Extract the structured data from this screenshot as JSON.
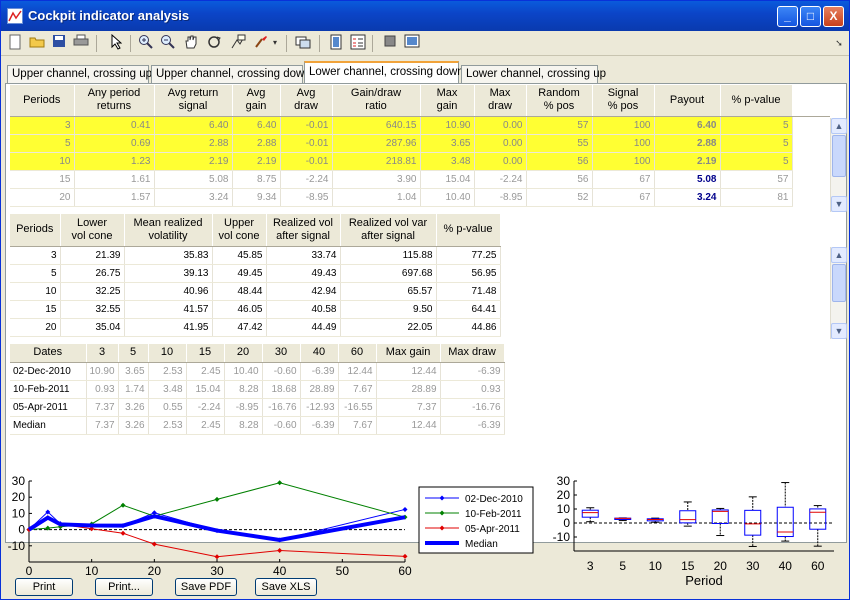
{
  "window": {
    "title": "Cockpit indicator analysis",
    "min_label": "_",
    "max_label": "□",
    "close_label": "X"
  },
  "toolbar": {
    "icons": [
      "new-icon",
      "open-icon",
      "save-icon",
      "print-icon",
      "pointer-icon",
      "zoom-in-icon",
      "zoom-out-icon",
      "pan-icon",
      "rotate-icon",
      "data-cursor-icon",
      "brush-icon",
      "link-icon",
      "dock-icon",
      "legend-icon",
      "grid-icon",
      "fit-icon"
    ]
  },
  "tabs": [
    {
      "label": "Upper channel, crossing up"
    },
    {
      "label": "Upper channel, crossing down"
    },
    {
      "label": "Lower channel, crossing down"
    },
    {
      "label": "Lower channel, crossing up"
    }
  ],
  "table1": {
    "headers": [
      "Periods",
      "Any period\nreturns",
      "Avg return\nsignal",
      "Avg\ngain",
      "Avg\ndraw",
      "Gain/draw\nratio",
      "Max\ngain",
      "Max\ndraw",
      "Random\n% pos",
      "Signal\n% pos",
      "Payout",
      "% p-value"
    ],
    "rows": [
      [
        "3",
        "0.41",
        "6.40",
        "6.40",
        "-0.01",
        "640.15",
        "10.90",
        "0.00",
        "57",
        "100",
        "6.40",
        "5"
      ],
      [
        "5",
        "0.69",
        "2.88",
        "2.88",
        "-0.01",
        "287.96",
        "3.65",
        "0.00",
        "55",
        "100",
        "2.88",
        "5"
      ],
      [
        "10",
        "1.23",
        "2.19",
        "2.19",
        "-0.01",
        "218.81",
        "3.48",
        "0.00",
        "56",
        "100",
        "2.19",
        "5"
      ],
      [
        "15",
        "1.61",
        "5.08",
        "8.75",
        "-2.24",
        "3.90",
        "15.04",
        "-2.24",
        "56",
        "67",
        "5.08",
        "57"
      ],
      [
        "20",
        "1.57",
        "3.24",
        "9.34",
        "-8.95",
        "1.04",
        "10.40",
        "-8.95",
        "52",
        "67",
        "3.24",
        "81"
      ]
    ]
  },
  "table2": {
    "headers": [
      "Periods",
      "Lower\nvol cone",
      "Mean realized\nvolatility",
      "Upper\nvol cone",
      "Realized vol\nafter signal",
      "Realized vol var\nafter signal",
      "% p-value"
    ],
    "rows": [
      [
        "3",
        "21.39",
        "35.83",
        "45.85",
        "33.74",
        "115.88",
        "77.25"
      ],
      [
        "5",
        "26.75",
        "39.13",
        "49.45",
        "49.43",
        "697.68",
        "56.95"
      ],
      [
        "10",
        "32.25",
        "40.96",
        "48.44",
        "42.94",
        "65.57",
        "71.48"
      ],
      [
        "15",
        "32.55",
        "41.57",
        "46.05",
        "40.58",
        "9.50",
        "64.41"
      ],
      [
        "20",
        "35.04",
        "41.95",
        "47.42",
        "44.49",
        "22.05",
        "44.86"
      ]
    ]
  },
  "table3": {
    "headers": [
      "Dates",
      "3",
      "5",
      "10",
      "15",
      "20",
      "30",
      "40",
      "60",
      "Max gain",
      "Max draw"
    ],
    "rows": [
      [
        "02-Dec-2010",
        "10.90",
        "3.65",
        "2.53",
        "2.45",
        "10.40",
        "-0.60",
        "-6.39",
        "12.44",
        "12.44",
        "-6.39"
      ],
      [
        "10-Feb-2011",
        "0.93",
        "1.74",
        "3.48",
        "15.04",
        "8.28",
        "18.68",
        "28.89",
        "7.67",
        "28.89",
        "0.93"
      ],
      [
        "05-Apr-2011",
        "7.37",
        "3.26",
        "0.55",
        "-2.24",
        "-8.95",
        "-16.76",
        "-12.93",
        "-16.55",
        "7.37",
        "-16.76"
      ],
      [
        "Median",
        "7.37",
        "3.26",
        "2.53",
        "2.45",
        "8.28",
        "-0.60",
        "-6.39",
        "7.67",
        "12.44",
        "-6.39"
      ]
    ]
  },
  "buttons": {
    "print": "Print",
    "print_dialog": "Print...",
    "save_pdf": "Save PDF",
    "save_xls": "Save XLS"
  },
  "chart_data": [
    {
      "type": "line",
      "x": [
        0,
        3,
        5,
        10,
        15,
        20,
        30,
        40,
        60
      ],
      "xlim": [
        0,
        60
      ],
      "ylim": [
        -20,
        30
      ],
      "xticks": [
        0,
        10,
        20,
        30,
        40,
        50,
        60
      ],
      "yticks": [
        -10,
        0,
        10,
        20,
        30
      ],
      "legend_position": "top-right",
      "series": [
        {
          "name": "02-Dec-2010",
          "color": "#0000ff",
          "values": [
            0,
            10.9,
            3.65,
            2.53,
            2.45,
            10.4,
            -0.6,
            -6.39,
            12.44
          ]
        },
        {
          "name": "10-Feb-2011",
          "color": "#008000",
          "values": [
            0,
            0.93,
            1.74,
            3.48,
            15.04,
            8.28,
            18.68,
            28.89,
            7.67
          ]
        },
        {
          "name": "05-Apr-2011",
          "color": "#e00000",
          "values": [
            0,
            7.37,
            3.26,
            0.55,
            -2.24,
            -8.95,
            -16.76,
            -12.93,
            -16.55
          ]
        },
        {
          "name": "Median",
          "color": "#0000ff",
          "values": [
            0,
            7.37,
            3.26,
            2.53,
            2.45,
            8.28,
            -0.6,
            -6.39,
            7.67
          ]
        }
      ]
    },
    {
      "type": "box",
      "categories": [
        "3",
        "5",
        "10",
        "15",
        "20",
        "30",
        "40",
        "60"
      ],
      "xlabel": "Period",
      "ylim": [
        -20,
        30
      ],
      "yticks": [
        -10,
        0,
        10,
        20,
        30
      ],
      "boxes": [
        {
          "min": 0.93,
          "q1": 4.15,
          "median": 7.37,
          "q3": 9.14,
          "max": 10.9
        },
        {
          "min": 1.74,
          "q1": 2.5,
          "median": 3.26,
          "q3": 3.46,
          "max": 3.65
        },
        {
          "min": 0.55,
          "q1": 1.54,
          "median": 2.53,
          "q3": 3.01,
          "max": 3.48
        },
        {
          "min": -2.24,
          "q1": 0.11,
          "median": 2.45,
          "q3": 8.75,
          "max": 15.04
        },
        {
          "min": -8.95,
          "q1": -0.34,
          "median": 8.28,
          "q3": 9.34,
          "max": 10.4
        },
        {
          "min": -16.76,
          "q1": -8.68,
          "median": -0.6,
          "q3": 9.04,
          "max": 18.68
        },
        {
          "min": -12.93,
          "q1": -9.66,
          "median": -6.39,
          "q3": 11.25,
          "max": 28.89
        },
        {
          "min": -16.55,
          "q1": -4.44,
          "median": 7.67,
          "q3": 10.06,
          "max": 12.44
        }
      ]
    }
  ]
}
